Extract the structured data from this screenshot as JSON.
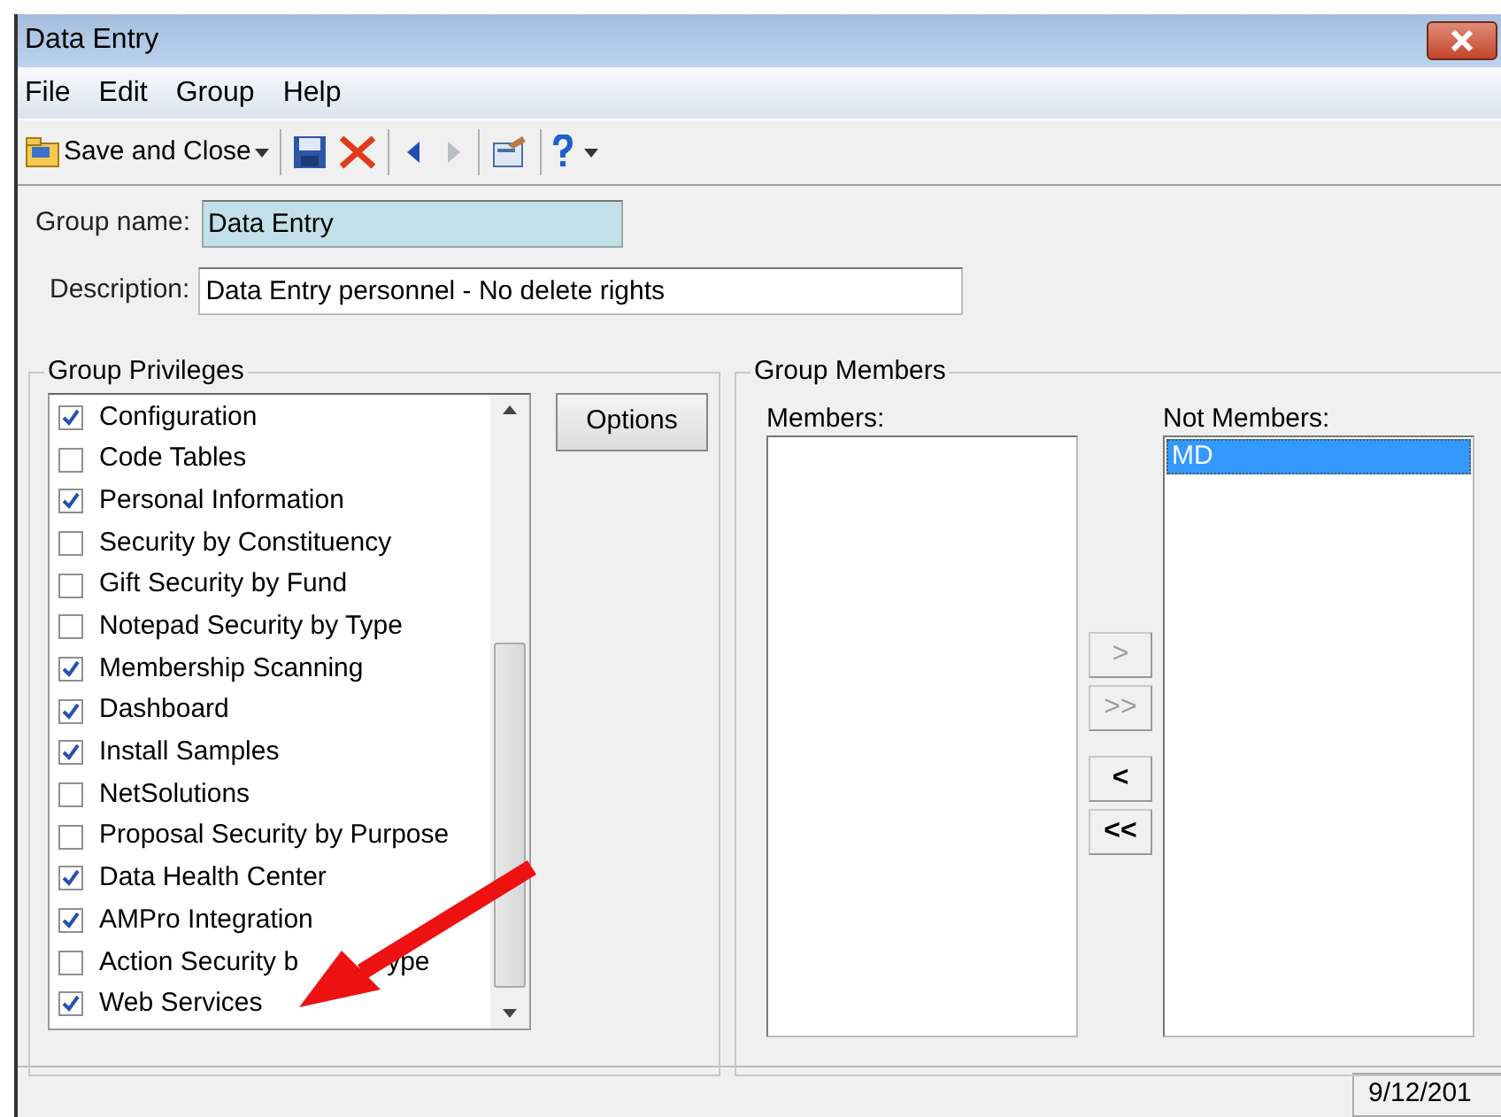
{
  "window": {
    "title": "Data Entry"
  },
  "menu": [
    "File",
    "Edit",
    "Group",
    "Help"
  ],
  "toolbar": {
    "save_and_close": "Save and Close"
  },
  "group_name": {
    "label": "Group name:",
    "value": "Data Entry"
  },
  "description": {
    "label": "Description:",
    "value": "Data Entry personnel - No delete rights"
  },
  "group_privileges": {
    "title": "Group Privileges",
    "options_button": "Options",
    "items": [
      {
        "label": "Configuration",
        "checked": true
      },
      {
        "label": "Code Tables",
        "checked": false
      },
      {
        "label": "Personal Information",
        "checked": true
      },
      {
        "label": "Security by Constituency",
        "checked": false
      },
      {
        "label": "Gift Security by Fund",
        "checked": false
      },
      {
        "label": "Notepad Security by Type",
        "checked": false
      },
      {
        "label": "Membership Scanning",
        "checked": true
      },
      {
        "label": "Dashboard",
        "checked": true
      },
      {
        "label": "Install Samples",
        "checked": true
      },
      {
        "label": "NetSolutions",
        "checked": false
      },
      {
        "label": "Proposal Security by Purpose",
        "checked": false
      },
      {
        "label": "Data Health Center",
        "checked": true
      },
      {
        "label": "AMPro Integration",
        "checked": true
      },
      {
        "label": "Action Security b",
        "label_after_arrow": "ype",
        "checked": false
      },
      {
        "label": "Web Services",
        "checked": true
      }
    ]
  },
  "group_members": {
    "title": "Group Members",
    "members_label": "Members:",
    "not_members_label": "Not Members:",
    "not_members": [
      {
        "label": "MD",
        "selected": true
      }
    ],
    "move_buttons": [
      {
        "label": ">",
        "disabled": true
      },
      {
        "label": ">>",
        "disabled": true
      },
      {
        "label": "<",
        "disabled": false
      },
      {
        "label": "<<",
        "disabled": false
      }
    ]
  },
  "status_bar": {
    "date": "9/12/201"
  }
}
